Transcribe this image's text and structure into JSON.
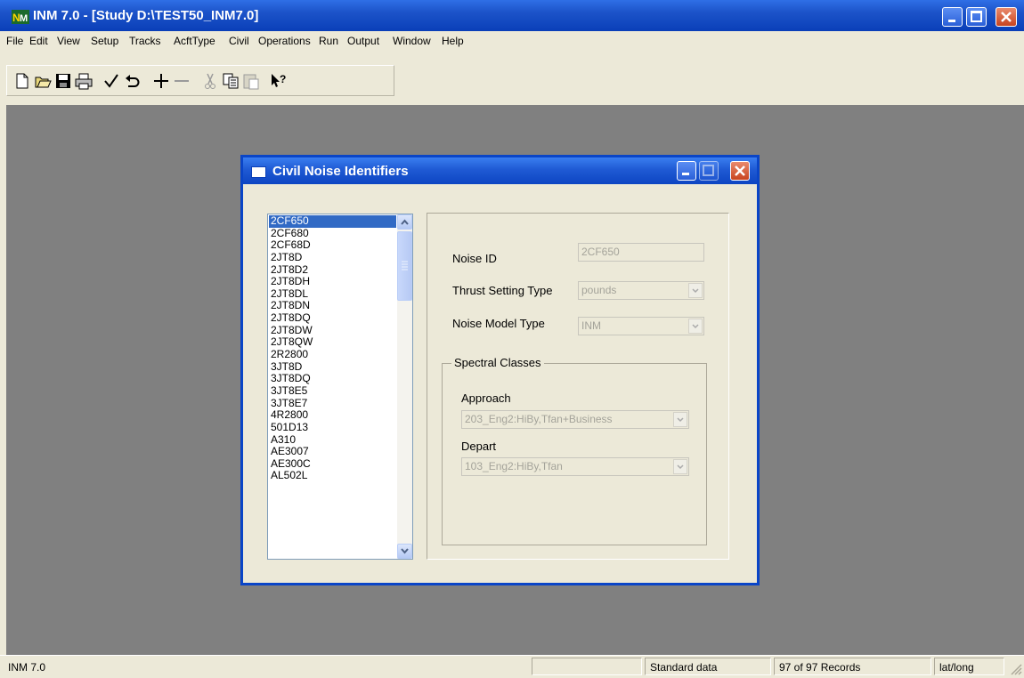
{
  "window": {
    "title": "INM 7.0 - [Study D:\\TEST50_INM7.0]"
  },
  "menu": [
    "File",
    "Edit",
    "View",
    "Setup",
    "Tracks",
    "AcftType",
    "Civil",
    "Operations",
    "Run",
    "Output",
    "Window",
    "Help"
  ],
  "toolbar": {
    "buttons": [
      "new-icon",
      "open-icon",
      "save-icon",
      "print-icon",
      "check-icon",
      "undo-icon",
      "add-icon",
      "remove-icon",
      "cut-icon",
      "copy-icon",
      "paste-icon",
      "context-help-icon"
    ]
  },
  "dialog": {
    "title": "Civil Noise Identifiers",
    "list": {
      "items": [
        "2CF650",
        "2CF680",
        "2CF68D",
        "2JT8D",
        "2JT8D2",
        "2JT8DH",
        "2JT8DL",
        "2JT8DN",
        "2JT8DQ",
        "2JT8DW",
        "2JT8QW",
        "2R2800",
        "3JT8D",
        "3JT8DQ",
        "3JT8E5",
        "3JT8E7",
        "4R2800",
        "501D13",
        "A310",
        "AE3007",
        "AE300C",
        "AL502L"
      ],
      "selected": "2CF650"
    },
    "noise_id": {
      "label": "Noise ID",
      "value": "2CF650"
    },
    "thrust_setting_type": {
      "label": "Thrust Setting Type",
      "value": "pounds"
    },
    "noise_model_type": {
      "label": "Noise Model Type",
      "value": "INM"
    },
    "spectral_classes": {
      "legend": "Spectral Classes",
      "approach": {
        "label": "Approach",
        "value": "203_Eng2:HiBy,Tfan+Business"
      },
      "depart": {
        "label": "Depart",
        "value": "103_Eng2:HiBy,Tfan"
      }
    }
  },
  "statusbar": {
    "app": "INM 7.0",
    "data": "Standard data",
    "records": "97 of 97 Records",
    "coords": "lat/long"
  },
  "colors": {
    "titlebar": "#0a3fb8",
    "selection": "#316ac5",
    "desktop": "#808080",
    "chrome": "#ece9d8"
  }
}
